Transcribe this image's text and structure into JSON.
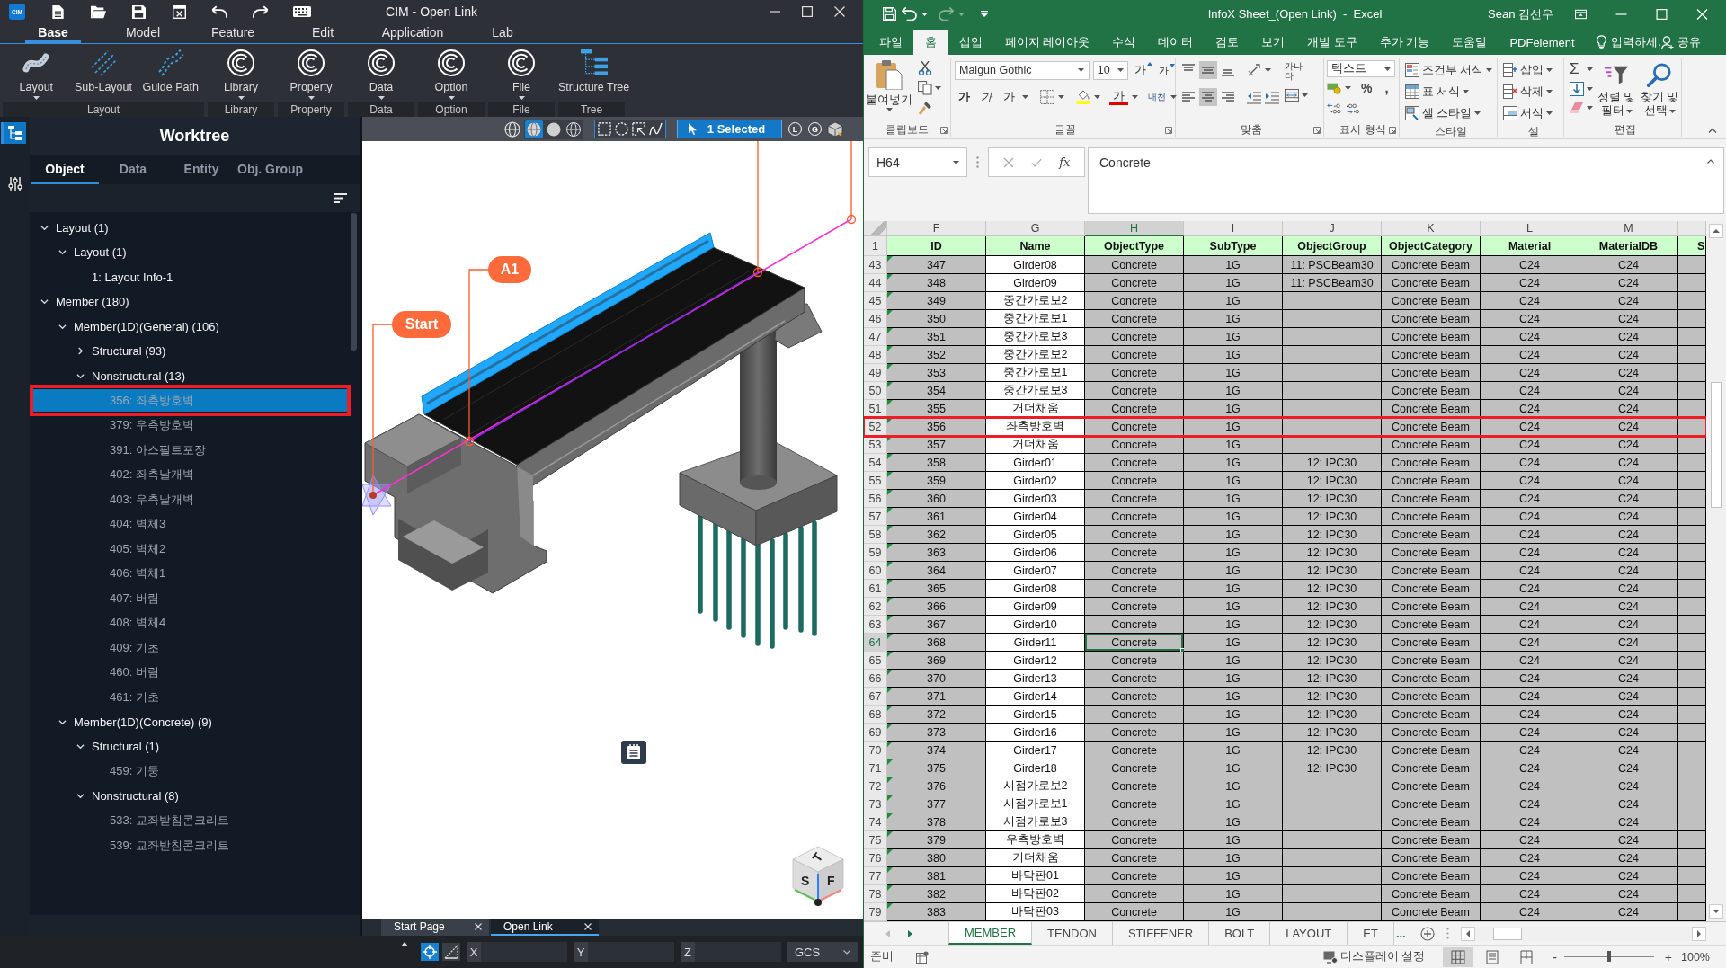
{
  "cim": {
    "logo": "CIM",
    "title": "CIM - Open Link",
    "menu_tabs": [
      {
        "label": "Base",
        "selected": true
      },
      {
        "label": "Model",
        "selected": false
      },
      {
        "label": "Feature",
        "selected": false
      },
      {
        "label": "Edit",
        "selected": false
      },
      {
        "label": "Application",
        "selected": false
      },
      {
        "label": "Lab",
        "selected": false
      }
    ],
    "ribbon_groups": [
      {
        "label": "Layout",
        "buttons": [
          {
            "label": "Layout",
            "kind": "curve",
            "has_menu": true
          },
          {
            "label": "Sub-Layout",
            "kind": "dashes",
            "has_menu": false
          },
          {
            "label": "Guide Path",
            "kind": "path",
            "has_menu": false
          }
        ]
      },
      {
        "label": "Library",
        "buttons": [
          {
            "label": "Library",
            "kind": "ring",
            "has_menu": true
          }
        ]
      },
      {
        "label": "Property",
        "buttons": [
          {
            "label": "Property",
            "kind": "ring",
            "has_menu": true
          }
        ]
      },
      {
        "label": "Data",
        "buttons": [
          {
            "label": "Data",
            "kind": "ring",
            "has_menu": true
          }
        ]
      },
      {
        "label": "Option",
        "buttons": [
          {
            "label": "Option",
            "kind": "ring",
            "has_menu": true
          }
        ]
      },
      {
        "label": "File",
        "buttons": [
          {
            "label": "File",
            "kind": "ring",
            "has_menu": true
          }
        ]
      },
      {
        "label": "Tree",
        "buttons": [
          {
            "label": "Structure Tree",
            "kind": "tree",
            "has_menu": false
          }
        ]
      }
    ],
    "side_tools": [
      {
        "kind": "tree",
        "selected": true
      },
      {
        "kind": "sliders",
        "selected": false
      }
    ],
    "worktree": {
      "title": "Worktree",
      "tabs": [
        {
          "label": "Object",
          "selected": true
        },
        {
          "label": "Data",
          "selected": false
        },
        {
          "label": "Entity",
          "selected": false
        },
        {
          "label": "Obj. Group",
          "selected": false
        }
      ],
      "nodes": [
        {
          "label": "Layout (1)",
          "expanded": true,
          "selected": false,
          "dimmed": false,
          "children": [
            {
              "label": "Layout (1)",
              "expanded": true,
              "selected": false,
              "dimmed": false,
              "children": [
                {
                  "label": "1: Layout Info-1",
                  "selected": false,
                  "dimmed": false
                }
              ]
            }
          ]
        },
        {
          "label": "Member (180)",
          "expanded": true,
          "selected": false,
          "dimmed": false,
          "children": [
            {
              "label": "Member(1D)(General) (106)",
              "expanded": true,
              "selected": false,
              "dimmed": false,
              "children": [
                {
                  "label": "Structural (93)",
                  "expanded": false,
                  "selected": false,
                  "dimmed": false
                },
                {
                  "label": "Nonstructural (13)",
                  "expanded": true,
                  "selected": false,
                  "dimmed": false,
                  "children": [
                    {
                      "label": "356: 좌측방호벽",
                      "selected": true,
                      "dimmed": true
                    },
                    {
                      "label": "379: 우측방호벽",
                      "selected": false,
                      "dimmed": true
                    },
                    {
                      "label": "391: 아스팔트포장",
                      "selected": false,
                      "dimmed": true
                    },
                    {
                      "label": "402: 좌측날개벽",
                      "selected": false,
                      "dimmed": true
                    },
                    {
                      "label": "403: 우측날개벽",
                      "selected": false,
                      "dimmed": true
                    },
                    {
                      "label": "404: 벽체3",
                      "selected": false,
                      "dimmed": true
                    },
                    {
                      "label": "405: 벽체2",
                      "selected": false,
                      "dimmed": true
                    },
                    {
                      "label": "406: 벽체1",
                      "selected": false,
                      "dimmed": true
                    },
                    {
                      "label": "407: 버림",
                      "selected": false,
                      "dimmed": true
                    },
                    {
                      "label": "408: 벽체4",
                      "selected": false,
                      "dimmed": true
                    },
                    {
                      "label": "409: 기초",
                      "selected": false,
                      "dimmed": true
                    },
                    {
                      "label": "460: 버림",
                      "selected": false,
                      "dimmed": true
                    },
                    {
                      "label": "461: 기초",
                      "selected": false,
                      "dimmed": true
                    }
                  ]
                }
              ]
            },
            {
              "label": "Member(1D)(Concrete) (9)",
              "expanded": true,
              "selected": false,
              "dimmed": false,
              "children": [
                {
                  "label": "Structural (1)",
                  "expanded": true,
                  "selected": false,
                  "dimmed": false,
                  "children": [
                    {
                      "label": "459: 기둥",
                      "selected": false,
                      "dimmed": true
                    }
                  ]
                },
                {
                  "label": "Nonstructural (8)",
                  "expanded": true,
                  "selected": false,
                  "dimmed": false,
                  "children": [
                    {
                      "label": "533: 교좌받침콘크리트",
                      "selected": false,
                      "dimmed": true
                    },
                    {
                      "label": "539: 교좌받침콘크리트",
                      "selected": false,
                      "dimmed": true
                    }
                  ]
                }
              ]
            }
          ]
        }
      ]
    },
    "viewport": {
      "render_modes": [
        {
          "kind": "shaded",
          "selected": true
        },
        {
          "kind": "solid",
          "selected": false
        },
        {
          "kind": "wire",
          "selected": false
        }
      ],
      "pick_modes": [
        {
          "kind": "rect"
        },
        {
          "kind": "circle"
        },
        {
          "kind": "lasso"
        },
        {
          "kind": "polyline"
        }
      ],
      "selection": "1 Selected",
      "toggles": [
        "L",
        "G"
      ],
      "callouts": [
        "Start",
        "A1"
      ],
      "view_cube": {
        "top": "T",
        "left": "S",
        "right": "F"
      }
    },
    "doc_tabs": [
      {
        "label": "Start Page",
        "selected": false
      },
      {
        "label": "Open Link",
        "selected": true
      }
    ],
    "status_bar": {
      "snap_tools": [
        {
          "kind": "snap",
          "selected": true
        },
        {
          "kind": "angle",
          "selected": false
        }
      ],
      "axes": [
        "X",
        "Y",
        "Z"
      ],
      "coordinate_system": "GCS"
    }
  },
  "excel": {
    "title": "InfoX Sheet_(Open Link)  -  Excel",
    "user": "Sean 김선우",
    "redo": {
      "disabled": true
    },
    "tabs": [
      {
        "label": "파일",
        "selected": false
      },
      {
        "label": "홈",
        "selected": true
      },
      {
        "label": "삽입",
        "selected": false
      },
      {
        "label": "페이지 레이아웃",
        "selected": false
      },
      {
        "label": "수식",
        "selected": false
      },
      {
        "label": "데이터",
        "selected": false
      },
      {
        "label": "검토",
        "selected": false
      },
      {
        "label": "보기",
        "selected": false
      },
      {
        "label": "개발 도구",
        "selected": false
      },
      {
        "label": "추가 기능",
        "selected": false
      },
      {
        "label": "도움말",
        "selected": false
      },
      {
        "label": "PDFelement",
        "selected": false
      }
    ],
    "tell_me": "입력하세.",
    "share": "공유",
    "ribbon": {
      "clipboard": {
        "label": "클립보드",
        "paste": "붙여넣기"
      },
      "font": {
        "label": "글꼴",
        "name": "Malgun Gothic",
        "size": "10",
        "grow": "가",
        "shrink": "가",
        "bold": "가",
        "italic": "가",
        "underline": "가",
        "font_color": "가",
        "phonetic": "내천"
      },
      "alignment": {
        "label": "맞춤",
        "vertical": [
          {
            "kind": "top",
            "selected": false
          },
          {
            "kind": "middle",
            "selected": true
          },
          {
            "kind": "bottom",
            "selected": false
          }
        ],
        "horizontal": [
          {
            "kind": "left",
            "selected": false
          },
          {
            "kind": "center",
            "selected": true
          },
          {
            "kind": "right",
            "selected": false
          }
        ],
        "wrap": "가나다"
      },
      "number": {
        "label": "표시 형식",
        "format": "텍스트",
        "percent": "%",
        "comma": ","
      },
      "styles": {
        "label": "스타일",
        "items": [
          {
            "label": "조건부 서식",
            "kind": "conditional"
          },
          {
            "label": "표 서식",
            "kind": "table"
          },
          {
            "label": "셀 스타일",
            "kind": "cell_style"
          }
        ]
      },
      "cells": {
        "label": "셀",
        "items": [
          {
            "label": "삽입",
            "kind": "insert"
          },
          {
            "label": "삭제",
            "kind": "delete"
          },
          {
            "label": "서식",
            "kind": "format"
          }
        ]
      },
      "editing": {
        "label": "편집",
        "autosum": "Σ",
        "sort": "정렬 및 필터",
        "find": "찾기 및 선택"
      }
    },
    "formula_bar": {
      "name_box": "H64",
      "function_label": "fx",
      "value": "Concrete"
    },
    "columns": [
      {
        "letter": "F",
        "selected": false
      },
      {
        "letter": "G",
        "selected": false
      },
      {
        "letter": "H",
        "selected": true
      },
      {
        "letter": "I",
        "selected": false
      },
      {
        "letter": "J",
        "selected": false
      },
      {
        "letter": "K",
        "selected": false
      },
      {
        "letter": "L",
        "selected": false
      },
      {
        "letter": "M",
        "selected": false
      }
    ],
    "header_row": {
      "number": "1",
      "cells": [
        "ID",
        "Name",
        "ObjectType",
        "SubType",
        "ObjectGroup",
        "ObjectCategory",
        "Material",
        "MaterialDB",
        "S"
      ]
    },
    "rows": [
      {
        "number": "43",
        "selected": false,
        "marked": false,
        "warning": true,
        "id": "347",
        "name": "Girder08",
        "object_type": "Concrete",
        "sub_type": "1G",
        "object_group": "11: PSCBeam30",
        "object_category": "Concrete Beam",
        "material": "C24",
        "material_db": "C24"
      },
      {
        "number": "44",
        "selected": false,
        "marked": false,
        "warning": true,
        "id": "348",
        "name": "Girder09",
        "object_type": "Concrete",
        "sub_type": "1G",
        "object_group": "11: PSCBeam30",
        "object_category": "Concrete Beam",
        "material": "C24",
        "material_db": "C24"
      },
      {
        "number": "45",
        "selected": false,
        "marked": false,
        "warning": true,
        "id": "349",
        "name": "중간가로보2",
        "object_type": "Concrete",
        "sub_type": "1G",
        "object_category": "Concrete Beam",
        "material": "C24",
        "material_db": "C24"
      },
      {
        "number": "46",
        "selected": false,
        "marked": false,
        "warning": true,
        "id": "350",
        "name": "중간가로보1",
        "object_type": "Concrete",
        "sub_type": "1G",
        "object_category": "Concrete Beam",
        "material": "C24",
        "material_db": "C24"
      },
      {
        "number": "47",
        "selected": false,
        "marked": false,
        "warning": true,
        "id": "351",
        "name": "중간가로보3",
        "object_type": "Concrete",
        "sub_type": "1G",
        "object_category": "Concrete Beam",
        "material": "C24",
        "material_db": "C24"
      },
      {
        "number": "48",
        "selected": false,
        "marked": false,
        "warning": true,
        "id": "352",
        "name": "중간가로보2",
        "object_type": "Concrete",
        "sub_type": "1G",
        "object_category": "Concrete Beam",
        "material": "C24",
        "material_db": "C24"
      },
      {
        "number": "49",
        "selected": false,
        "marked": false,
        "warning": true,
        "id": "353",
        "name": "중간가로보1",
        "object_type": "Concrete",
        "sub_type": "1G",
        "object_category": "Concrete Beam",
        "material": "C24",
        "material_db": "C24"
      },
      {
        "number": "50",
        "selected": false,
        "marked": false,
        "warning": true,
        "id": "354",
        "name": "중간가로보3",
        "object_type": "Concrete",
        "sub_type": "1G",
        "object_category": "Concrete Beam",
        "material": "C24",
        "material_db": "C24"
      },
      {
        "number": "51",
        "selected": false,
        "marked": false,
        "warning": true,
        "id": "355",
        "name": "거더채움",
        "object_type": "Concrete",
        "sub_type": "1G",
        "object_category": "Concrete Beam",
        "material": "C24",
        "material_db": "C24"
      },
      {
        "number": "52",
        "selected": false,
        "marked": true,
        "warning": true,
        "id": "356",
        "name": "좌측방호벽",
        "object_type": "Concrete",
        "sub_type": "1G",
        "object_category": "Concrete Beam",
        "material": "C24",
        "material_db": "C24"
      },
      {
        "number": "53",
        "selected": false,
        "marked": false,
        "warning": true,
        "id": "357",
        "name": "거더채움",
        "object_type": "Concrete",
        "sub_type": "1G",
        "object_category": "Concrete Beam",
        "material": "C24",
        "material_db": "C24"
      },
      {
        "number": "54",
        "selected": false,
        "marked": false,
        "warning": true,
        "id": "358",
        "name": "Girder01",
        "object_type": "Concrete",
        "sub_type": "1G",
        "object_group": "12: IPC30",
        "object_category": "Concrete Beam",
        "material": "C24",
        "material_db": "C24"
      },
      {
        "number": "55",
        "selected": false,
        "marked": false,
        "warning": true,
        "id": "359",
        "name": "Girder02",
        "object_type": "Concrete",
        "sub_type": "1G",
        "object_group": "12: IPC30",
        "object_category": "Concrete Beam",
        "material": "C24",
        "material_db": "C24"
      },
      {
        "number": "56",
        "selected": false,
        "marked": false,
        "warning": true,
        "id": "360",
        "name": "Girder03",
        "object_type": "Concrete",
        "sub_type": "1G",
        "object_group": "12: IPC30",
        "object_category": "Concrete Beam",
        "material": "C24",
        "material_db": "C24"
      },
      {
        "number": "57",
        "selected": false,
        "marked": false,
        "warning": true,
        "id": "361",
        "name": "Girder04",
        "object_type": "Concrete",
        "sub_type": "1G",
        "object_group": "12: IPC30",
        "object_category": "Concrete Beam",
        "material": "C24",
        "material_db": "C24"
      },
      {
        "number": "58",
        "selected": false,
        "marked": false,
        "warning": true,
        "id": "362",
        "name": "Girder05",
        "object_type": "Concrete",
        "sub_type": "1G",
        "object_group": "12: IPC30",
        "object_category": "Concrete Beam",
        "material": "C24",
        "material_db": "C24"
      },
      {
        "number": "59",
        "selected": false,
        "marked": false,
        "warning": true,
        "id": "363",
        "name": "Girder06",
        "object_type": "Concrete",
        "sub_type": "1G",
        "object_group": "12: IPC30",
        "object_category": "Concrete Beam",
        "material": "C24",
        "material_db": "C24"
      },
      {
        "number": "60",
        "selected": false,
        "marked": false,
        "warning": true,
        "id": "364",
        "name": "Girder07",
        "object_type": "Concrete",
        "sub_type": "1G",
        "object_group": "12: IPC30",
        "object_category": "Concrete Beam",
        "material": "C24",
        "material_db": "C24"
      },
      {
        "number": "61",
        "selected": false,
        "marked": false,
        "warning": true,
        "id": "365",
        "name": "Girder08",
        "object_type": "Concrete",
        "sub_type": "1G",
        "object_group": "12: IPC30",
        "object_category": "Concrete Beam",
        "material": "C24",
        "material_db": "C24"
      },
      {
        "number": "62",
        "selected": false,
        "marked": false,
        "warning": true,
        "id": "366",
        "name": "Girder09",
        "object_type": "Concrete",
        "sub_type": "1G",
        "object_group": "12: IPC30",
        "object_category": "Concrete Beam",
        "material": "C24",
        "material_db": "C24"
      },
      {
        "number": "63",
        "selected": false,
        "marked": false,
        "warning": true,
        "id": "367",
        "name": "Girder10",
        "object_type": "Concrete",
        "sub_type": "1G",
        "object_group": "12: IPC30",
        "object_category": "Concrete Beam",
        "material": "C24",
        "material_db": "C24"
      },
      {
        "number": "64",
        "selected": true,
        "marked": false,
        "warning": true,
        "id": "368",
        "name": "Girder11",
        "object_type": "Concrete",
        "sub_type": "1G",
        "object_group": "12: IPC30",
        "object_category": "Concrete Beam",
        "material": "C24",
        "material_db": "C24"
      },
      {
        "number": "65",
        "selected": false,
        "marked": false,
        "warning": true,
        "id": "369",
        "name": "Girder12",
        "object_type": "Concrete",
        "sub_type": "1G",
        "object_group": "12: IPC30",
        "object_category": "Concrete Beam",
        "material": "C24",
        "material_db": "C24"
      },
      {
        "number": "66",
        "selected": false,
        "marked": false,
        "warning": true,
        "id": "370",
        "name": "Girder13",
        "object_type": "Concrete",
        "sub_type": "1G",
        "object_group": "12: IPC30",
        "object_category": "Concrete Beam",
        "material": "C24",
        "material_db": "C24"
      },
      {
        "number": "67",
        "selected": false,
        "marked": false,
        "warning": true,
        "id": "371",
        "name": "Girder14",
        "object_type": "Concrete",
        "sub_type": "1G",
        "object_group": "12: IPC30",
        "object_category": "Concrete Beam",
        "material": "C24",
        "material_db": "C24"
      },
      {
        "number": "68",
        "selected": false,
        "marked": false,
        "warning": true,
        "id": "372",
        "name": "Girder15",
        "object_type": "Concrete",
        "sub_type": "1G",
        "object_group": "12: IPC30",
        "object_category": "Concrete Beam",
        "material": "C24",
        "material_db": "C24"
      },
      {
        "number": "69",
        "selected": false,
        "marked": false,
        "warning": true,
        "id": "373",
        "name": "Girder16",
        "object_type": "Concrete",
        "sub_type": "1G",
        "object_group": "12: IPC30",
        "object_category": "Concrete Beam",
        "material": "C24",
        "material_db": "C24"
      },
      {
        "number": "70",
        "selected": false,
        "marked": false,
        "warning": true,
        "id": "374",
        "name": "Girder17",
        "object_type": "Concrete",
        "sub_type": "1G",
        "object_group": "12: IPC30",
        "object_category": "Concrete Beam",
        "material": "C24",
        "material_db": "C24"
      },
      {
        "number": "71",
        "selected": false,
        "marked": false,
        "warning": true,
        "id": "375",
        "name": "Girder18",
        "object_type": "Concrete",
        "sub_type": "1G",
        "object_group": "12: IPC30",
        "object_category": "Concrete Beam",
        "material": "C24",
        "material_db": "C24"
      },
      {
        "number": "72",
        "selected": false,
        "marked": false,
        "warning": true,
        "id": "376",
        "name": "시점가로보2",
        "object_type": "Concrete",
        "sub_type": "1G",
        "object_category": "Concrete Beam",
        "material": "C24",
        "material_db": "C24"
      },
      {
        "number": "73",
        "selected": false,
        "marked": false,
        "warning": true,
        "id": "377",
        "name": "시점가로보1",
        "object_type": "Concrete",
        "sub_type": "1G",
        "object_category": "Concrete Beam",
        "material": "C24",
        "material_db": "C24"
      },
      {
        "number": "74",
        "selected": false,
        "marked": false,
        "warning": true,
        "id": "378",
        "name": "시점가로보3",
        "object_type": "Concrete",
        "sub_type": "1G",
        "object_category": "Concrete Beam",
        "material": "C24",
        "material_db": "C24"
      },
      {
        "number": "75",
        "selected": false,
        "marked": false,
        "warning": true,
        "id": "379",
        "name": "우측방호벽",
        "object_type": "Concrete",
        "sub_type": "1G",
        "object_category": "Concrete Beam",
        "material": "C24",
        "material_db": "C24"
      },
      {
        "number": "76",
        "selected": false,
        "marked": false,
        "warning": true,
        "id": "380",
        "name": "거더채움",
        "object_type": "Concrete",
        "sub_type": "1G",
        "object_category": "Concrete Beam",
        "material": "C24",
        "material_db": "C24"
      },
      {
        "number": "77",
        "selected": false,
        "marked": false,
        "warning": true,
        "id": "381",
        "name": "바닥판01",
        "object_type": "Concrete",
        "sub_type": "1G",
        "object_category": "Concrete Beam",
        "material": "C24",
        "material_db": "C24"
      },
      {
        "number": "78",
        "selected": false,
        "marked": false,
        "warning": true,
        "id": "382",
        "name": "바닥판02",
        "object_type": "Concrete",
        "sub_type": "1G",
        "object_category": "Concrete Beam",
        "material": "C24",
        "material_db": "C24"
      },
      {
        "number": "79",
        "selected": false,
        "marked": false,
        "warning": true,
        "id": "383",
        "name": "바닥판03",
        "object_type": "Concrete",
        "sub_type": "1G",
        "object_category": "Concrete Beam",
        "material": "C24",
        "material_db": "C24"
      }
    ],
    "sheet_tabs": [
      {
        "label": "MEMBER",
        "selected": true
      },
      {
        "label": "TENDON",
        "selected": false
      },
      {
        "label": "STIFFENER",
        "selected": false
      },
      {
        "label": "BOLT",
        "selected": false
      },
      {
        "label": "LAYOUT",
        "selected": false
      },
      {
        "label": "ET",
        "selected": false
      }
    ],
    "more_tabs": "...",
    "status_bar": {
      "ready": "준비",
      "display_settings": "디스플레이 설정",
      "views": [
        {
          "kind": "normal",
          "selected": true
        },
        {
          "kind": "page_layout",
          "selected": false
        },
        {
          "kind": "page_break",
          "selected": false
        }
      ],
      "zoom_out": "-",
      "zoom_in": "+",
      "zoom_slider": {
        "level": 0.5
      },
      "zoom": "100%"
    }
  }
}
